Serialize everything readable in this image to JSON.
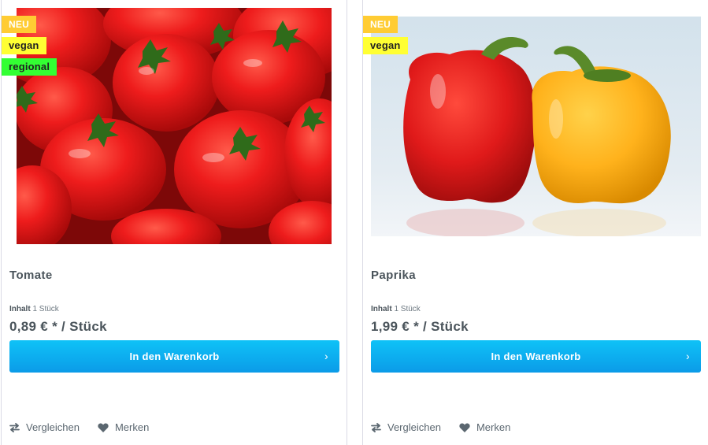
{
  "products": [
    {
      "badges": {
        "new": "NEU",
        "vegan": "vegan",
        "regional": "regional"
      },
      "name": "Tomate",
      "inhalt_label": "Inhalt",
      "inhalt_value": "1 Stück",
      "price": "0,89 € * / Stück",
      "buy_label": "In den Warenkorb",
      "compare_label": "Vergleichen",
      "wishlist_label": "Merken",
      "image": "tomatoes-photo"
    },
    {
      "badges": {
        "new": "NEU",
        "vegan": "vegan"
      },
      "name": "Paprika",
      "inhalt_label": "Inhalt",
      "inhalt_value": "1 Stück",
      "price": "1,99 € * / Stück",
      "buy_label": "In den Warenkorb",
      "compare_label": "Vergleichen",
      "wishlist_label": "Merken",
      "image": "bell-peppers-photo"
    }
  ],
  "colors": {
    "badge_new": "#ffcc33",
    "badge_vegan": "#ffff33",
    "badge_regional": "#33ff33",
    "button": "#0fc2f7",
    "text": "#4a545b"
  }
}
